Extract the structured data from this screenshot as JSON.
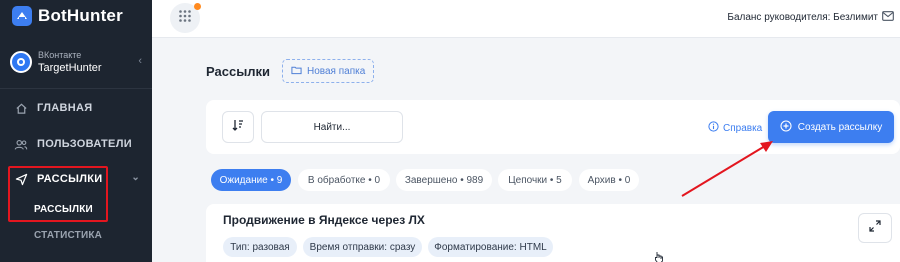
{
  "brand": {
    "name": "BotHunter"
  },
  "account": {
    "network": "ВКонтакте",
    "name": "TargetHunter"
  },
  "sidebar": {
    "items": [
      {
        "label": "ГЛАВНАЯ",
        "icon": "home-icon"
      },
      {
        "label": "ПОЛЬЗОВАТЕЛИ",
        "icon": "users-icon"
      },
      {
        "label": "РАССЫЛКИ",
        "icon": "send-icon"
      }
    ],
    "subitems": [
      {
        "label": "РАССЫЛКИ"
      },
      {
        "label": "СТАТИСТИКА"
      }
    ]
  },
  "topbar": {
    "balance": "Баланс руководителя: Безлимит"
  },
  "main": {
    "title": "Рассылки",
    "new_folder": "Новая папка",
    "search_placeholder": "Найти...",
    "help": "Справка",
    "create": "Создать рассылку",
    "filters": [
      {
        "label": "Ожидание • 9",
        "active": true
      },
      {
        "label": "В обработке • 0",
        "active": false
      },
      {
        "label": "Завершено • 989",
        "active": false
      },
      {
        "label": "Цепочки • 5",
        "active": false
      },
      {
        "label": "Архив • 0",
        "active": false
      }
    ],
    "card": {
      "title": "Продвижение в Яндексе через ЛХ",
      "tags": [
        "Тип: разовая",
        "Время отправки: сразу",
        "Форматирование: HTML"
      ]
    }
  },
  "colors": {
    "accent": "#3d7ef0",
    "sidebar": "#1d2530",
    "annotation": "#e3161f",
    "notification": "#ff8a1f"
  }
}
